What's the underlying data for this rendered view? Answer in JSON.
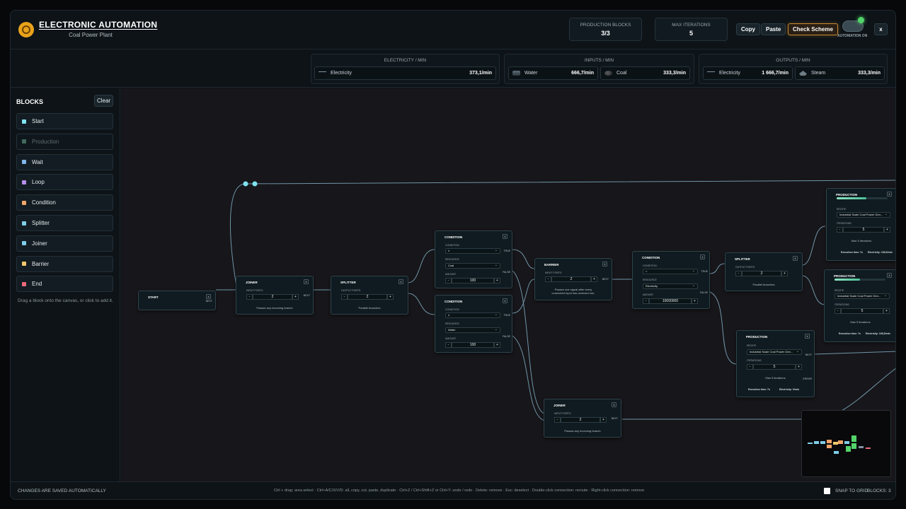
{
  "header": {
    "title": "ELECTRONIC AUTOMATION",
    "subtitle": "Coal Power Plant",
    "stats": [
      {
        "label": "PRODUCTION BLOCKS",
        "value": "3/3"
      },
      {
        "label": "MAX ITERATIONS",
        "value": "5"
      }
    ],
    "buttons": {
      "copy": "Copy",
      "paste": "Paste",
      "check": "Check Scheme",
      "close": "x"
    },
    "automation_label": "AUTOMATION ON"
  },
  "resources": {
    "electricity_title": "ELECTRICITY / MIN",
    "inputs_title": "INPUTS / MIN",
    "outputs_title": "OUTPUTS / MIN",
    "electricity": [
      {
        "name": "Electricity",
        "value": "373,1/min",
        "icon": "electricity-icon"
      }
    ],
    "inputs": [
      {
        "name": "Water",
        "value": "666,7/min",
        "icon": "water-icon"
      },
      {
        "name": "Coal",
        "value": "333,3/min",
        "icon": "coal-icon"
      }
    ],
    "outputs": [
      {
        "name": "Electricity",
        "value": "1 666,7/min",
        "icon": "electricity-icon"
      },
      {
        "name": "Steam",
        "value": "333,3/min",
        "icon": "steam-icon"
      }
    ]
  },
  "sidebar": {
    "title": "BLOCKS",
    "clear": "Clear",
    "items": [
      {
        "label": "Start",
        "color": "#7fe3f0"
      },
      {
        "label": "Production",
        "color": "#3f6b5c"
      },
      {
        "label": "Wait",
        "color": "#7fb6e8"
      },
      {
        "label": "Loop",
        "color": "#b58ee8"
      },
      {
        "label": "Condition",
        "color": "#f0a56a"
      },
      {
        "label": "Splitter",
        "color": "#7fcde8"
      },
      {
        "label": "Joiner",
        "color": "#7fcde8"
      },
      {
        "label": "Barrier",
        "color": "#f0c86a"
      },
      {
        "label": "End",
        "color": "#e86a7a"
      }
    ],
    "hint": "Drag a block onto the canvas, or click to add it."
  },
  "nodes": {
    "start": {
      "title": "START",
      "next": "NEXT"
    },
    "joiner1": {
      "title": "JOINER",
      "ports_label": "INPUT PORTS",
      "value": "2",
      "desc": "Passes any incoming branch",
      "next": "NEXT"
    },
    "splitter1": {
      "title": "SPLITTER",
      "ports_label": "OUTPUT PORTS",
      "value": "2",
      "desc": "Parallel branches"
    },
    "cond1": {
      "title": "CONDITION",
      "cond_label": "CONDITION",
      "cond": "≥",
      "res_label": "RESOURCE",
      "res": "Coal",
      "amt_label": "AMOUNT",
      "amt": "100",
      "true": "TRUE",
      "false": "FALSE"
    },
    "cond2": {
      "title": "CONDITION",
      "cond_label": "CONDITION",
      "cond": "≥",
      "res_label": "RESOURCE",
      "res": "Water",
      "amt_label": "AMOUNT",
      "amt": "100",
      "true": "TRUE",
      "false": "FALSE"
    },
    "barrier": {
      "title": "BARRIER",
      "ports_label": "INPUT PORTS",
      "value": "2",
      "desc": "Passes one signal after every connected input has received one.",
      "next": "NEXT"
    },
    "joiner2": {
      "title": "JOINER",
      "ports_label": "INPUT PORTS",
      "value": "2",
      "desc": "Passes any incoming branch",
      "next": "NEXT"
    },
    "cond3": {
      "title": "CONDITION",
      "cond_label": "CONDITION",
      "cond": "<",
      "res_label": "RESOURCE",
      "res": "Electricity",
      "amt_label": "AMOUNT",
      "amt": "10000000",
      "true": "TRUE",
      "false": "FALSE"
    },
    "splitter2": {
      "title": "SPLITTER",
      "ports_label": "OUTPUT PORTS",
      "value": "2",
      "desc": "Parallel branches"
    },
    "prod1": {
      "title": "PRODUCTION",
      "progress": 0.58,
      "recipe_label": "RECIPE",
      "recipe": "Industrial Scale Coal Power Gen...",
      "iter_label": "ITERATIONS",
      "iter": "5",
      "max": "Max 5 iterations",
      "exec": "Execution time: 7s",
      "elec": "Electricity: 106,5/min"
    },
    "prod2": {
      "title": "PRODUCTION",
      "progress": 0.5,
      "recipe_label": "RECIPE",
      "recipe": "Industrial Scale Coal Power Gen...",
      "iter_label": "ITERATIONS",
      "iter": "5",
      "max": "Max 5 iterations",
      "exec": "Execution time: 7s",
      "elec": "Electricity: 106,5/min"
    },
    "prod3": {
      "title": "PRODUCTION",
      "recipe_label": "RECIPE",
      "recipe": "Industrial Scale Coal Power Gen...",
      "iter_label": "ITERATIONS",
      "iter": "5",
      "max": "Max 5 iterations",
      "exec": "Execution time: 7s",
      "elec": "Electricity: 0/min",
      "next": "NEXT",
      "error": "ERROR"
    }
  },
  "stepper": {
    "minus": "-",
    "plus": "+"
  },
  "footer": {
    "saved": "CHANGES ARE SAVED AUTOMATICALLY",
    "shortcuts": "Ctrl + drag: area select · Ctrl+A/C/X/V/D: all, copy, cut, paste, duplicate · Ctrl+Z / Ctrl+Shift+Z or Ctrl+Y: undo / redo · Delete: remove · Esc: deselect · Double-click connection: reroute · Right-click connection: remove",
    "snap": "SNAP TO GRID",
    "blocks": "BLOCKS: 3"
  }
}
